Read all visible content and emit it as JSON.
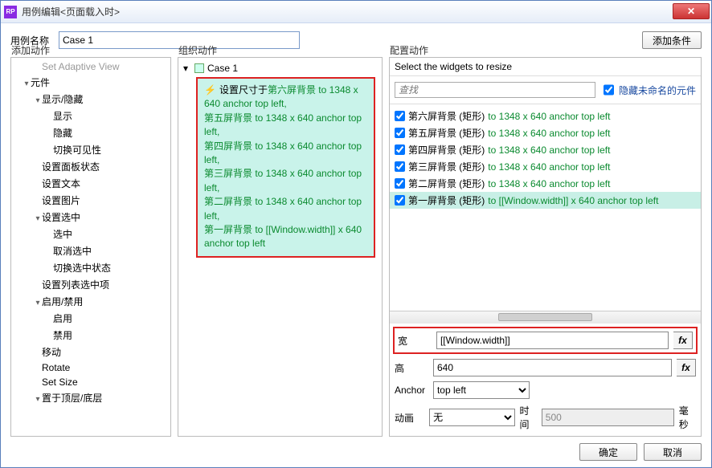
{
  "window": {
    "title": "用例编辑<页面载入时>"
  },
  "top": {
    "name_label": "用例名称",
    "name_value": "Case 1",
    "add_condition": "添加条件"
  },
  "cols": {
    "add_action": "添加动作",
    "organize": "组织动作",
    "configure": "配置动作"
  },
  "tree": [
    {
      "label": "Set Adaptive View",
      "level": 2,
      "leaf": true,
      "muted": true
    },
    {
      "label": "元件",
      "level": 1,
      "open": true
    },
    {
      "label": "显示/隐藏",
      "level": 2,
      "open": true
    },
    {
      "label": "显示",
      "level": 3,
      "leaf": true
    },
    {
      "label": "隐藏",
      "level": 3,
      "leaf": true
    },
    {
      "label": "切换可见性",
      "level": 3,
      "leaf": true
    },
    {
      "label": "设置面板状态",
      "level": 2,
      "leaf": true
    },
    {
      "label": "设置文本",
      "level": 2,
      "leaf": true
    },
    {
      "label": "设置图片",
      "level": 2,
      "leaf": true
    },
    {
      "label": "设置选中",
      "level": 2,
      "open": true
    },
    {
      "label": "选中",
      "level": 3,
      "leaf": true
    },
    {
      "label": "取消选中",
      "level": 3,
      "leaf": true
    },
    {
      "label": "切换选中状态",
      "level": 3,
      "leaf": true
    },
    {
      "label": "设置列表选中项",
      "level": 2,
      "leaf": true
    },
    {
      "label": "启用/禁用",
      "level": 2,
      "open": true
    },
    {
      "label": "启用",
      "level": 3,
      "leaf": true
    },
    {
      "label": "禁用",
      "level": 3,
      "leaf": true
    },
    {
      "label": "移动",
      "level": 2,
      "leaf": true
    },
    {
      "label": "Rotate",
      "level": 2,
      "leaf": true
    },
    {
      "label": "Set Size",
      "level": 2,
      "leaf": true
    },
    {
      "label": "置于顶层/底层",
      "level": 2,
      "open": true
    }
  ],
  "organize": {
    "case": "Case 1",
    "prefix": "设置尺寸于 ",
    "lines": [
      "第六屏背景 to 1348 x 640 anchor top left,",
      "第五屏背景 to 1348 x 640 anchor top left,",
      "第四屏背景 to 1348 x 640 anchor top left,",
      "第三屏背景 to 1348 x 640 anchor top left,",
      "第二屏背景 to 1348 x 640 anchor top left,",
      "第一屏背景 to [[Window.width]] x 640 anchor top left"
    ]
  },
  "config": {
    "select_label": "Select the widgets to resize",
    "search_placeholder": "查找",
    "hide_unnamed": "隐藏未命名的元件",
    "widgets": [
      {
        "name": "第六屏背景 (矩形)",
        "tail": " to 1348 x 640 anchor top left",
        "hl": false
      },
      {
        "name": "第五屏背景 (矩形)",
        "tail": " to 1348 x 640 anchor top left",
        "hl": false
      },
      {
        "name": "第四屏背景 (矩形)",
        "tail": " to 1348 x 640 anchor top left",
        "hl": false
      },
      {
        "name": "第三屏背景 (矩形)",
        "tail": " to 1348 x 640 anchor top left",
        "hl": false
      },
      {
        "name": "第二屏背景 (矩形)",
        "tail": " to 1348 x 640 anchor top left",
        "hl": false
      },
      {
        "name": "第一屏背景 (矩形)",
        "tail": " to [[Window.width]] x 640 anchor top left",
        "hl": true
      }
    ],
    "width_label": "宽",
    "width_value": "[[Window.width]]",
    "height_label": "高",
    "height_value": "640",
    "anchor_label": "Anchor",
    "anchor_value": "top left",
    "anim_label": "动画",
    "anim_value": "无",
    "time_label": "时间",
    "time_value": "500",
    "time_unit": "毫秒",
    "fx": "fx"
  },
  "footer": {
    "ok": "确定",
    "cancel": "取消"
  }
}
